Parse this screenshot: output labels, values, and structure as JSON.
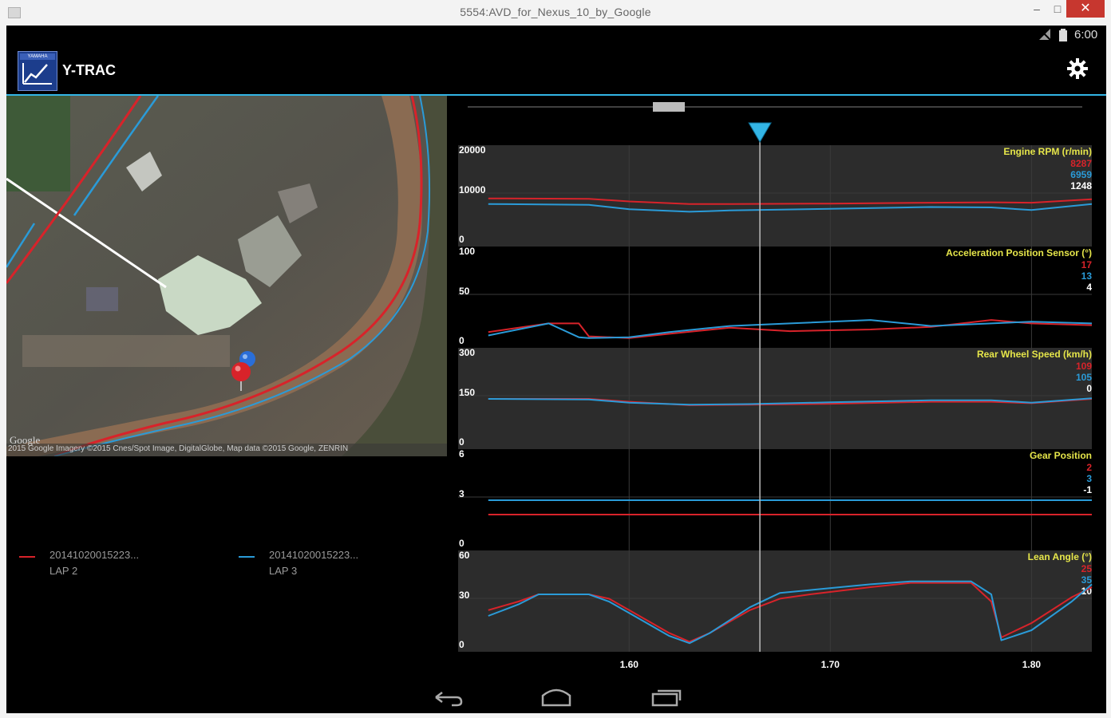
{
  "window": {
    "title": "5554:AVD_for_Nexus_10_by_Google",
    "minimize_label": "–",
    "maximize_label": "□",
    "close_label": "✕"
  },
  "status_bar": {
    "time": "6:00",
    "icons": [
      "signal-icon",
      "battery-icon"
    ]
  },
  "app": {
    "logo_text": "YAMAHA",
    "title": "Y-TRAC",
    "settings_icon": "gear-icon"
  },
  "map": {
    "google_label": "Google",
    "attribution": "2015 Google Imagery ©2015 Cnes/Spot Image, DigitalGlobe, Map data ©2015 Google, ZENRIN"
  },
  "legend": [
    {
      "name": "20141020015223...",
      "lap": "LAP 2",
      "color": "#d8232a"
    },
    {
      "name": "20141020015223...",
      "lap": "LAP 3",
      "color": "#2a9bd8"
    }
  ],
  "colors": {
    "lap2": "#d8232a",
    "lap3": "#2a9bd8",
    "accent": "#33b5e5",
    "title_yellow": "#e6e64a"
  },
  "charts": {
    "cursor_x": 1.665,
    "x_ticks": [
      "1.60",
      "1.70",
      "1.80"
    ]
  },
  "chart_data": [
    {
      "type": "line",
      "title": "Engine RPM (r/min)",
      "ylim": [
        0,
        20000
      ],
      "yticks": [
        "20000",
        "10000",
        "0"
      ],
      "readouts": [
        {
          "text": "8287",
          "color": "red"
        },
        {
          "text": "6959",
          "color": "blue"
        },
        {
          "text": "1248",
          "color": "white"
        }
      ],
      "x": [
        1.53,
        1.58,
        1.6,
        1.63,
        1.65,
        1.7,
        1.75,
        1.78,
        1.8,
        1.83
      ],
      "series": [
        {
          "values": [
            9500,
            9400,
            8800,
            8200,
            8200,
            8300,
            8500,
            8600,
            8500,
            9300
          ]
        },
        {
          "values": [
            8200,
            8000,
            7000,
            6400,
            6700,
            7100,
            7500,
            7400,
            6800,
            8200
          ]
        }
      ]
    },
    {
      "type": "line",
      "title": "Acceleration Position Sensor (°)",
      "ylim": [
        0,
        100
      ],
      "yticks": [
        "100",
        "50",
        "0"
      ],
      "readouts": [
        {
          "text": "17",
          "color": "red"
        },
        {
          "text": "13",
          "color": "blue"
        },
        {
          "text": "4",
          "color": "white"
        }
      ],
      "x": [
        1.53,
        1.56,
        1.575,
        1.58,
        1.6,
        1.62,
        1.65,
        1.68,
        1.72,
        1.75,
        1.78,
        1.8,
        1.83
      ],
      "series": [
        {
          "values": [
            10,
            20,
            20,
            5,
            3,
            8,
            15,
            11,
            13,
            16,
            24,
            20,
            18
          ]
        },
        {
          "values": [
            6,
            20,
            4,
            3,
            4,
            10,
            17,
            20,
            24,
            17,
            20,
            22,
            20
          ]
        }
      ]
    },
    {
      "type": "line",
      "title": "Rear Wheel Speed (km/h)",
      "ylim": [
        0,
        300
      ],
      "yticks": [
        "300",
        "150",
        "0"
      ],
      "readouts": [
        {
          "text": "109",
          "color": "red"
        },
        {
          "text": "105",
          "color": "blue"
        },
        {
          "text": "0",
          "color": "white"
        }
      ],
      "x": [
        1.53,
        1.58,
        1.6,
        1.63,
        1.66,
        1.7,
        1.75,
        1.78,
        1.8,
        1.83
      ],
      "series": [
        {
          "values": [
            150,
            150,
            140,
            128,
            130,
            133,
            140,
            140,
            135,
            150
          ]
        },
        {
          "values": [
            150,
            148,
            137,
            130,
            132,
            138,
            145,
            145,
            137,
            152
          ]
        }
      ]
    },
    {
      "type": "line",
      "title": "Gear Position",
      "ylim": [
        0,
        6
      ],
      "yticks": [
        "6",
        "3",
        "0"
      ],
      "readouts": [
        {
          "text": "2",
          "color": "red"
        },
        {
          "text": "3",
          "color": "blue"
        },
        {
          "text": "-1",
          "color": "white"
        }
      ],
      "x": [
        1.53,
        1.83
      ],
      "series": [
        {
          "values": [
            2,
            2
          ]
        },
        {
          "values": [
            3,
            3
          ]
        }
      ]
    },
    {
      "type": "line",
      "title": "Lean Angle (°)",
      "ylim": [
        0,
        60
      ],
      "yticks": [
        "60",
        "30",
        "0"
      ],
      "readouts": [
        {
          "text": "25",
          "color": "red"
        },
        {
          "text": "35",
          "color": "blue"
        },
        {
          "text": "10",
          "color": "white"
        }
      ],
      "x": [
        1.53,
        1.545,
        1.555,
        1.58,
        1.59,
        1.6,
        1.62,
        1.63,
        1.64,
        1.66,
        1.675,
        1.69,
        1.72,
        1.74,
        1.77,
        1.78,
        1.785,
        1.8,
        1.82,
        1.83
      ],
      "series": [
        {
          "values": [
            24,
            30,
            35,
            35,
            32,
            24,
            8,
            2,
            8,
            24,
            32,
            35,
            40,
            43,
            43,
            30,
            5,
            15,
            33,
            40
          ]
        },
        {
          "values": [
            20,
            28,
            35,
            35,
            30,
            22,
            6,
            1,
            8,
            26,
            36,
            38,
            42,
            44,
            44,
            35,
            3,
            10,
            30,
            42
          ]
        }
      ]
    }
  ]
}
